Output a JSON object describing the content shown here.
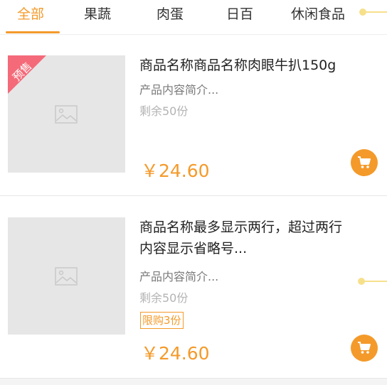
{
  "tabs": [
    {
      "label": "全部",
      "active": true
    },
    {
      "label": "果蔬",
      "active": false
    },
    {
      "label": "肉蛋",
      "active": false
    },
    {
      "label": "日百",
      "active": false
    },
    {
      "label": "休闲食品",
      "active": false
    }
  ],
  "products": [
    {
      "badge": "预售",
      "title": "商品名称商品名称肉眼牛扒150g",
      "desc": "产品内容简介...",
      "stock": "剩余50份",
      "price": "￥24.60",
      "thumb_icon": "image-placeholder-icon",
      "cart_icon": "cart-icon"
    },
    {
      "title_lines": [
        "商品名称最多显示两行，超过两行",
        "内容显示省略号..."
      ],
      "desc": "产品内容简介...",
      "stock": "剩余50份",
      "limit": "限购3份",
      "price": "￥24.60",
      "thumb_icon": "image-placeholder-icon",
      "cart_icon": "cart-icon"
    }
  ],
  "colors": {
    "accent": "#f49a2a",
    "badge": "#f46a79",
    "placeholder": "#e6e6e6"
  }
}
